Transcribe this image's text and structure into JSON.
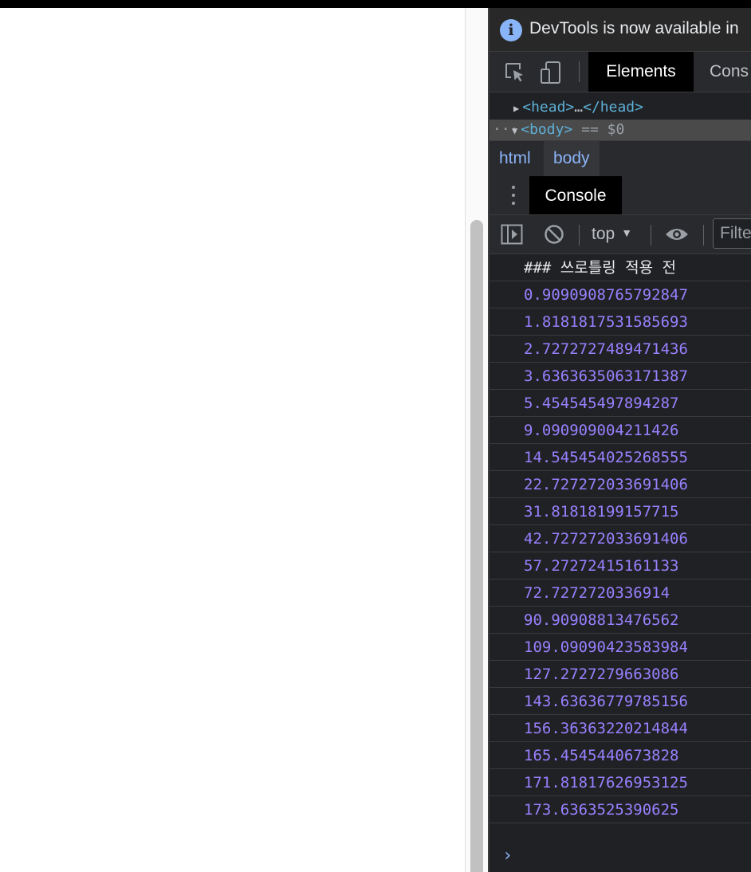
{
  "devtools": {
    "info_bar": {
      "text": "DevTools is now available in ",
      "icon": "info-icon"
    },
    "tabs": {
      "elements": "Elements",
      "console": "Cons"
    },
    "dom_tree": {
      "head_open": "<head>",
      "head_ellipsis": "…",
      "head_close": "</head>",
      "body_tag": "<body>",
      "body_eq": " == $0",
      "row_ellipsis": "···"
    },
    "breadcrumbs": [
      "html",
      "body"
    ],
    "drawer": {
      "tab": "Console"
    },
    "console_toolbar": {
      "context": "top",
      "filter_placeholder": "Filte"
    },
    "console_lines": [
      "### 쓰로틀링 적용 전",
      "0.9090908765792847",
      "1.8181817531585693",
      "2.7272727489471436",
      "3.6363635063171387",
      "5.454545497894287",
      "9.090909004211426",
      "14.545454025268555",
      "22.727272033691406",
      "31.81818199157715",
      "42.727272033691406",
      "57.27272415161133",
      "72.7272720336914",
      "90.90908813476562",
      "109.09090423583984",
      "127.2727279663086",
      "143.63636779785156",
      "156.36363220214844",
      "165.4545440673828",
      "171.81817626953125",
      "173.6363525390625"
    ],
    "prompt": ">"
  },
  "colors": {
    "panel_bg": "#202124",
    "number_color": "#9980ff",
    "link_color": "#8ab4f8",
    "tag_color": "#5db0d7"
  }
}
